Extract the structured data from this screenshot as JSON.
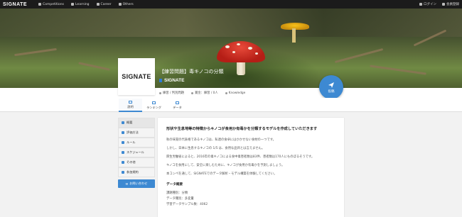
{
  "topnav": {
    "logo": "SIGNATE",
    "items": [
      {
        "label": "Competitions"
      },
      {
        "label": "Learning"
      },
      {
        "label": "Career"
      },
      {
        "label": "Others"
      }
    ],
    "login": "ログイン",
    "register": "会員登録"
  },
  "hero": {
    "title": "【練習問題】毒キノコの分類",
    "org": "SIGNATE",
    "logo_card": "SIGNATE"
  },
  "submit_label": "投稿",
  "meta": {
    "category": "練習 / 判別問題",
    "prize": "賞金：練習 / 0人",
    "type": "Knowledge"
  },
  "tabs": [
    {
      "label": "説明"
    },
    {
      "label": "ランキング"
    },
    {
      "label": "データ"
    }
  ],
  "sidemenu": {
    "items": [
      {
        "label": "概要"
      },
      {
        "label": "評価方法"
      },
      {
        "label": "ルール"
      },
      {
        "label": "スケジュール"
      },
      {
        "label": "その他"
      },
      {
        "label": "参加規約"
      }
    ],
    "qa_label": "お問い合わせ"
  },
  "content": {
    "lead": "形状や生息地等の特徴からキノコが食用か有毒かを分類するモデルを作成していただきます",
    "paras": [
      "秋の味覚の代表格であるキノコは、私達の食卓にはかかせない食材の一つです。",
      "しかし、日本に生息するキノコの 1/5 は、食用な品目とは言えません。",
      "厚生労働省によると、2016年の毒キノコによる食中毒患者数は83件、患者数は170人にものぼるそうです。",
      "キノコを食用にして、安全に楽しむために、キノコが食用か有毒かを予測しましょう。",
      "本コンペを通して、SIGNATEでのデータ解析・モデル構築を体験してください。"
    ],
    "data_heading": "データ概要",
    "data_lines": [
      "課題種別：分類",
      "データ種別：多変量",
      "学習データサンプル数：4062"
    ]
  }
}
